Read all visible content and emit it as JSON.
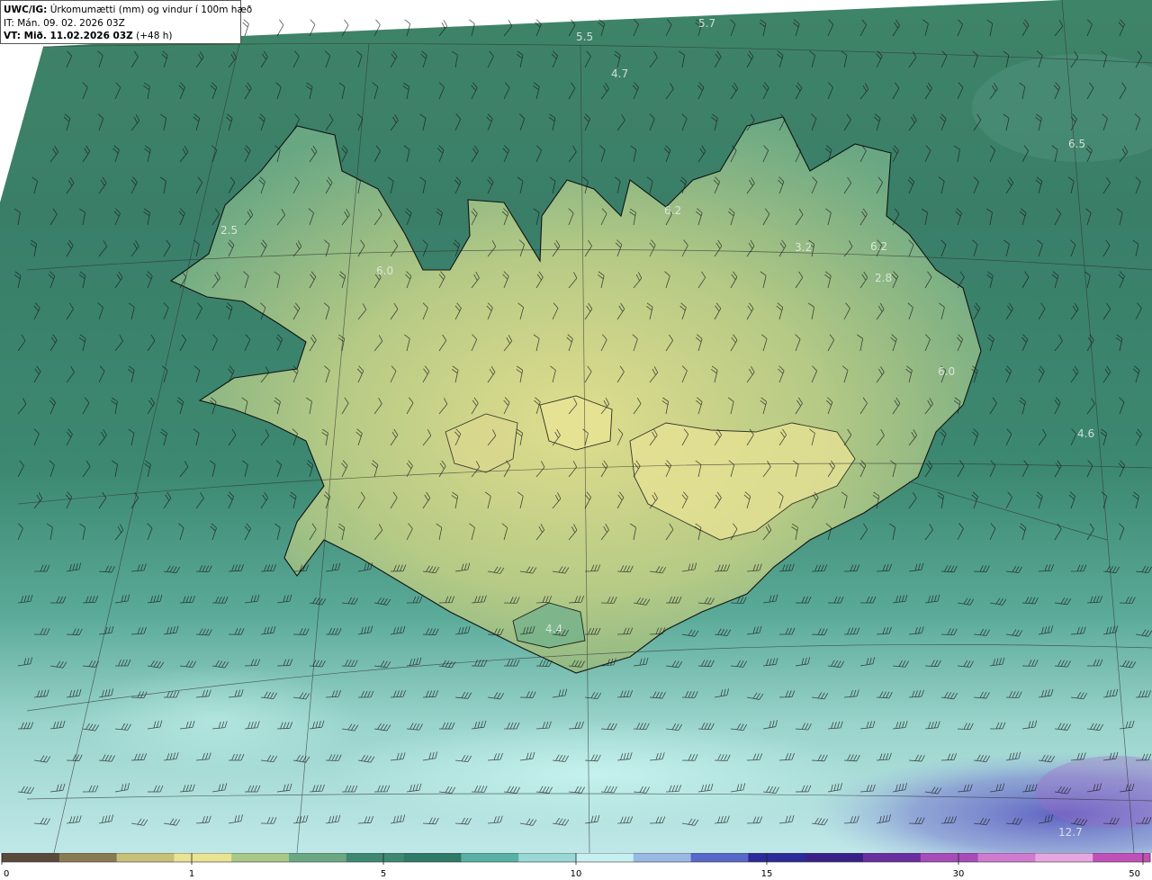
{
  "header": {
    "model_label": "UWC/IG:",
    "title": "Úrkomumætti (mm) og vindur í 100m hæð",
    "it_label": "IT:",
    "issue_time": "Mán. 09. 02. 2026 03Z",
    "vt_label": "VT: Mið. 11.02.2026 03Z",
    "lead_time": "(+48 h)"
  },
  "map_values": [
    "5.7",
    "5.5",
    "4.7",
    "6.5",
    "2.5",
    "6.0",
    "6.2",
    "3.2",
    "6.2",
    "2.8",
    "6.0",
    "4.6",
    "4.4",
    "12.7"
  ],
  "colorbar": {
    "ticks": [
      "0",
      "1",
      "5",
      "10",
      "15",
      "30",
      "50"
    ],
    "colors": [
      "#5a4a3c",
      "#8a7a52",
      "#c8c078",
      "#e8e494",
      "#a8c888",
      "#6aa884",
      "#3e8872",
      "#2e7a68",
      "#5ab0a4",
      "#9ad8d4",
      "#c8f0f0",
      "#9ab8e4",
      "#5868c8",
      "#2a2a98",
      "#382088",
      "#6a2ea0",
      "#a84ab8",
      "#d07ad0",
      "#e6a6e0",
      "#c050b8"
    ]
  },
  "icons": [
    "wind-barb-icon"
  ]
}
